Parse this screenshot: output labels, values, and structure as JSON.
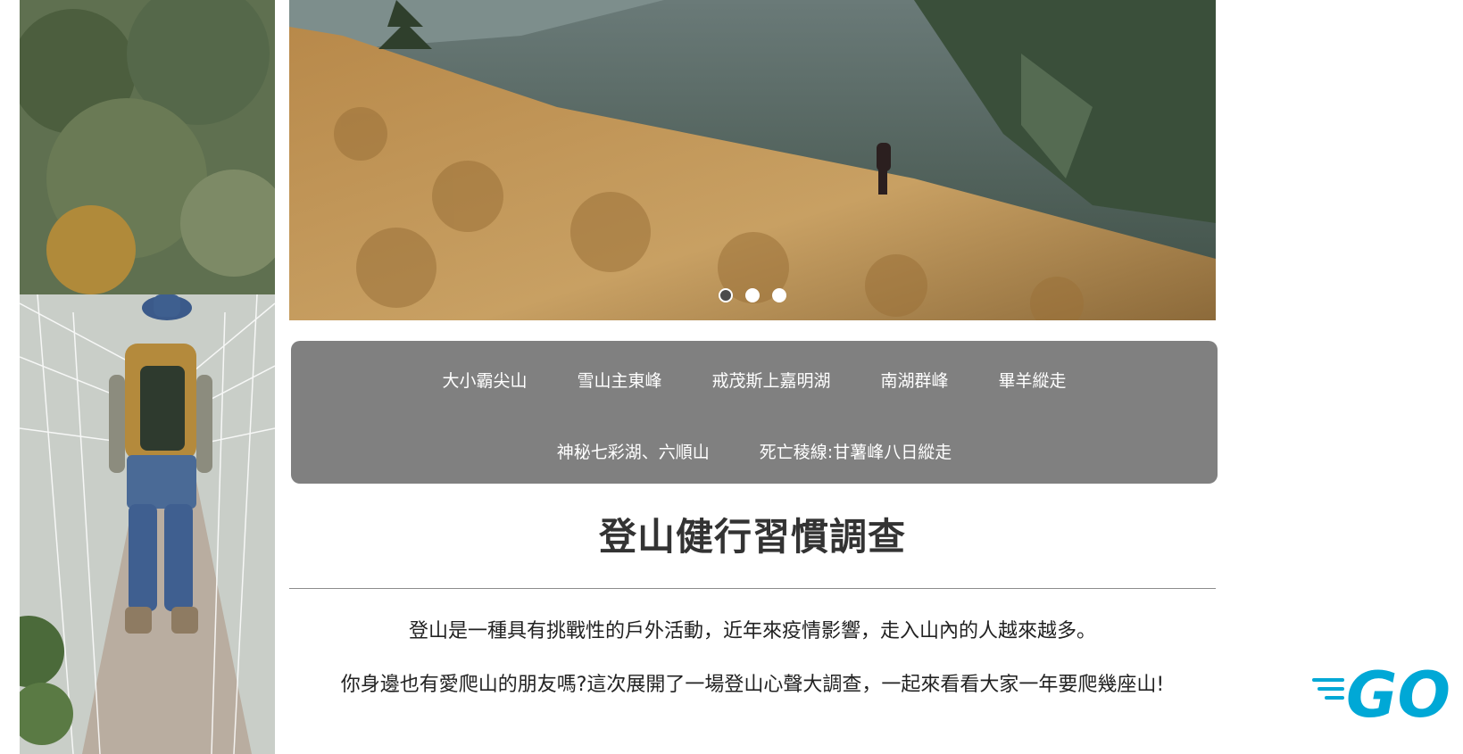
{
  "nav": {
    "row1": [
      "大小霸尖山",
      "雪山主東峰",
      "戒茂斯上嘉明湖",
      "南湖群峰",
      "畢羊縱走"
    ],
    "row2": [
      "神秘七彩湖、六順山",
      "死亡稜線:甘薯峰八日縱走"
    ]
  },
  "carousel": {
    "slide_count": 3,
    "active_index": 0
  },
  "content": {
    "title": "登山健行習慣調查",
    "paragraph1": "登山是一種具有挑戰性的戶外活動，近年來疫情影響，走入山內的人越來越多。",
    "paragraph2": "你身邊也有愛爬山的朋友嗎?這次展開了一場登山心聲大調查，一起來看看大家一年要爬幾座山!"
  },
  "logo": {
    "text": "GO",
    "color": "#00a8d6"
  },
  "colors": {
    "nav_bg": "#808080",
    "nav_text": "#ffffff",
    "title": "#333333"
  }
}
